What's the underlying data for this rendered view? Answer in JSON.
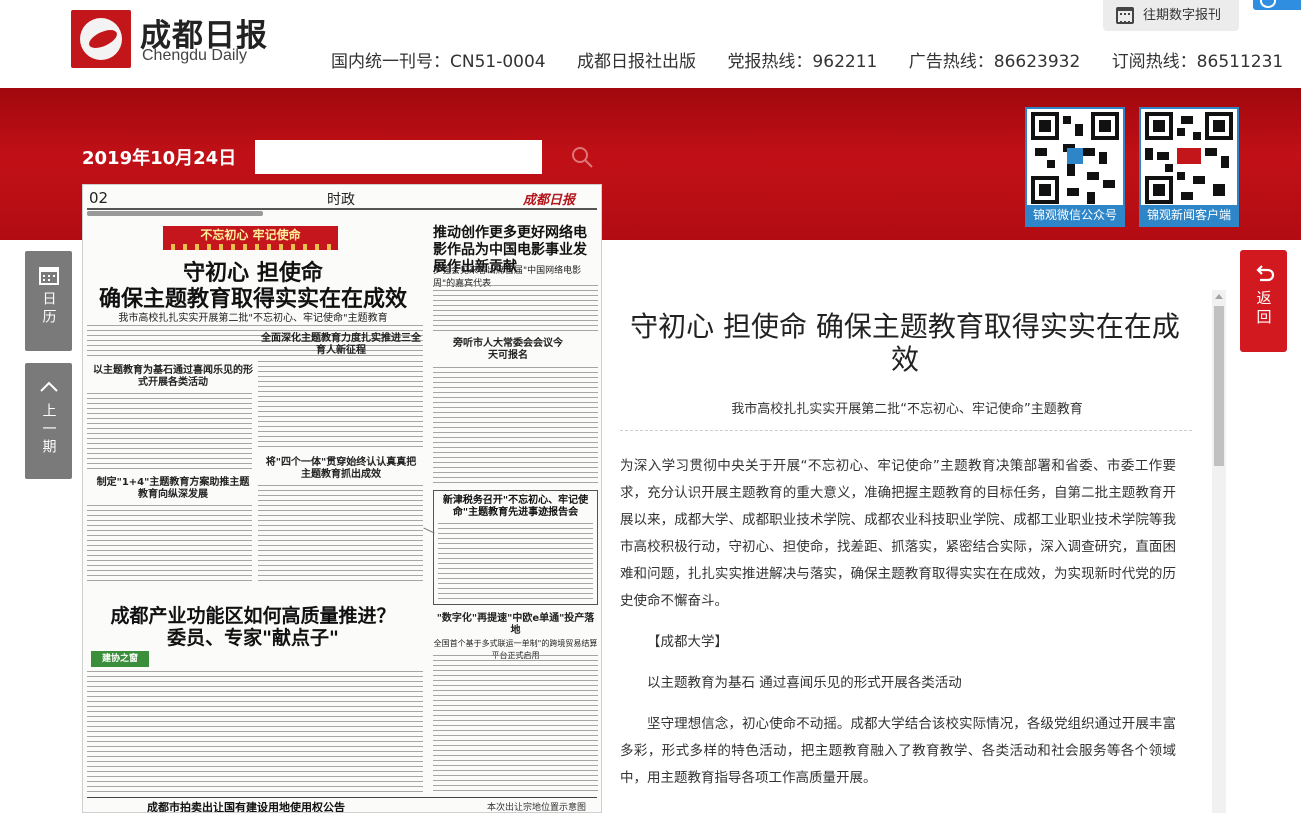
{
  "header": {
    "logo_cn": "成都日报",
    "logo_en": "Chengdu Daily",
    "info": [
      "国内统一刊号：CN51-0004",
      "成都日报社出版",
      "党报热线：962211",
      "广告热线：86623932",
      "订阅热线：86511231"
    ],
    "archive_label": "往期数字报刊"
  },
  "toolbar": {
    "date": "2019年10月24日",
    "search_placeholder": ""
  },
  "qr_codes": [
    {
      "caption": "锦观微信公众号"
    },
    {
      "caption": "锦观新闻客户端"
    }
  ],
  "newspaper": {
    "page_number": "02",
    "section": "时政",
    "brand": "成都日报",
    "tag": "不忘初心 牢记使命",
    "headline_line1": "守初心 担使命",
    "headline_line2": "确保主题教育取得实实在在成效",
    "headline_sub": "我市高校扎扎实实开展第二批\"不忘初心、牢记使命\"主题教育",
    "side_headline": "推动创作更多更好网络电影作品为中国电影事业发展作出新贡献",
    "side_sub": "罗强会见来蓉出席首届\"中国网络电影周\"的嘉宾代表",
    "side_small_1": "旁听市人大常委会会议今天可报名",
    "box_title": "新津税务召开\"不忘初心、牢记使命\"主题教育先进事迹报告会",
    "sub_1": "以主题教育为基石通过喜闻乐见的形式开展各类活动",
    "sub_2": "全面深化主题教育力度扎实推进三全育人新征程",
    "sub_3": "制定\"1+4\"主题教育方案助推主题教育向纵深发展",
    "sub_4": "将\"四个一体\"贯穿始终认认真真把主题教育抓出成效",
    "headline_2_line1": "成都产业功能区如何高质量推进？",
    "headline_2_line2": "委员、专家\"献点子\"",
    "green_tag": "建协之窗",
    "side_small_2": "\"数字化\"再提速\"中欧e单通\"投产落地",
    "side_small_2_sub": "全国首个基于多式联运一单制\"的跨境贸易结算平台正式启用",
    "bottom_headline": "成都市拍卖出让国有建设用地使用权公告",
    "bottom_right": "本次出让宗地位置示意图"
  },
  "nav": {
    "calendar_label": "日历",
    "prev_label": "上一期",
    "back_label": "返回"
  },
  "article": {
    "title": "守初心 担使命 确保主题教育取得实实在在成效",
    "subtitle": "我市高校扎扎实实开展第二批“不忘初心、牢记使命”主题教育",
    "paragraphs": [
      "为深入学习贯彻中央关于开展“不忘初心、牢记使命”主题教育决策部署和省委、市委工作要求，充分认识开展主题教育的重大意义，准确把握主题教育的目标任务，自第二批主题教育开展以来，成都大学、成都职业技术学院、成都农业科技职业学院、成都工业职业技术学院等我市高校积极行动，守初心、担使命，找差距、抓落实，紧密结合实际，深入调查研究，直面困难和问题，扎扎实实推进解决与落实，确保主题教育取得实实在在成效，为实现新时代党的历史使命不懈奋斗。",
      "【成都大学】",
      "以主题教育为基石 通过喜闻乐见的形式开展各类活动",
      "坚守理想信念，初心使命不动摇。成都大学结合该校实际情况，各级党组织通过开展丰富多彩，形式多样的特色活动，把主题教育融入了教育教学、各类活动和社会服务等各个领域中，用主题教育指导各项工作高质量开展。"
    ]
  },
  "colors": {
    "brand_red": "#c3161b",
    "band_red": "#b20c12",
    "qr_blue": "#2e86c9",
    "nav_gray": "#7a7a7a"
  }
}
